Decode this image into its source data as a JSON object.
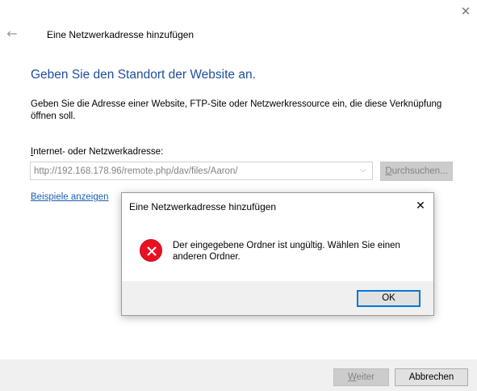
{
  "window": {
    "close_glyph": "✕",
    "back_glyph": "←",
    "title": "Eine Netzwerkadresse hinzufügen"
  },
  "main": {
    "heading": "Geben Sie den Standort der Website an.",
    "description": "Geben Sie die Adresse einer Website, FTP-Site oder Netzwerkressource ein, die diese Verknüpfung öffnen soll.",
    "address_label_mnemonic": "I",
    "address_label_rest": "nternet- oder Netzwerkadresse:",
    "address_value": "http://192.168.178.96/remote.php/dav/files/Aaron/",
    "combo_arrow_glyph": "⌵",
    "browse_mnemonic": "D",
    "browse_rest": "urchsuchen...",
    "examples_link": "Beispiele anzeigen"
  },
  "footer": {
    "next_mnemonic": "W",
    "next_rest": "eiter",
    "cancel_label": "Abbrechen"
  },
  "modal": {
    "title": "Eine Netzwerkadresse hinzufügen",
    "close_glyph": "✕",
    "message": "Der eingegebene Ordner ist ungültig. Wählen Sie einen anderen Ordner.",
    "ok_label": "OK",
    "icon": "error-icon"
  },
  "colors": {
    "heading_blue": "#1f4e9c",
    "link_blue": "#1a5fb4",
    "error_red": "#e81123",
    "focus_blue": "#0078d7",
    "footer_gray": "#f0f0f0"
  }
}
